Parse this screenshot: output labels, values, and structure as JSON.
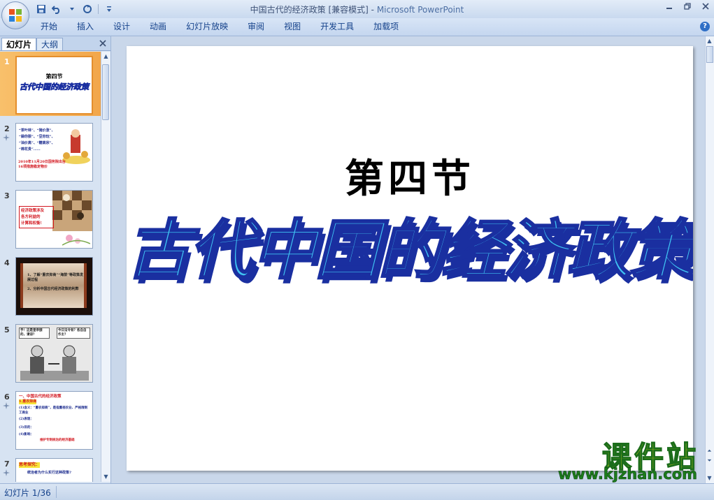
{
  "window": {
    "doc_title": "中国古代的经济政策 [兼容模式]",
    "separator": " - ",
    "app_name": "Microsoft PowerPoint"
  },
  "ribbon": {
    "tabs": [
      "开始",
      "插入",
      "设计",
      "动画",
      "幻灯片放映",
      "审阅",
      "视图",
      "开发工具",
      "加载项"
    ]
  },
  "left_pane": {
    "tab_slides": "幻灯片",
    "tab_outline": "大纲",
    "slides": [
      {
        "num": "1",
        "selected": true,
        "title": "第四节",
        "subtitle": "古代中国的经济政策"
      },
      {
        "num": "2",
        "selected": false,
        "lines": [
          "“茶叶林”、“猪价涨”、",
          "“蒜你狠”、“豆你玩”、",
          "“油价高”、“糖高宗”、",
          "“棉花贵”……"
        ],
        "caption": "2010年11月20日国务院出台16项措施稳定物价"
      },
      {
        "num": "3",
        "selected": false,
        "lines": [
          "经济政策涉及",
          "各方利益的",
          "计算和权衡!"
        ]
      },
      {
        "num": "4",
        "selected": false,
        "lines": [
          "1、了解“重农抑商”“海禁”等政策发展过程",
          "2、分析中国古代经济政策的利弊"
        ]
      },
      {
        "num": "5",
        "selected": false,
        "lines": [
          "手！这是皇帝颁的，请谅？",
          "今日法令有？各自自作主？"
        ]
      },
      {
        "num": "6",
        "selected": false,
        "lines": [
          "一、中国古代的经济政策",
          "1.重农抑商",
          "(1)含义：“重农抑商”，是指重视农业、严格限制工商业",
          "(2)表现：",
          "(3)目的：",
          "(4)影响：",
          "维护专制统治的经济基础"
        ]
      },
      {
        "num": "7",
        "selected": false,
        "lines": [
          "思考探究：",
          "统治者为什么实行这种政策?"
        ]
      }
    ]
  },
  "slide": {
    "title": "第四节",
    "subtitle": "古代中国的经济政策"
  },
  "watermark": {
    "cn": "课件站",
    "url": "www.kjzhan.com"
  },
  "status": {
    "slide_indicator": "幻灯片 1/36"
  },
  "colors": {
    "subtitle_fill": "#3fc3f2",
    "subtitle_stroke": "#1a2fa0",
    "selected_thumb": "#f2a64a",
    "watermark_yellow": "#f7ea1c",
    "watermark_green": "#1c7d1c"
  }
}
